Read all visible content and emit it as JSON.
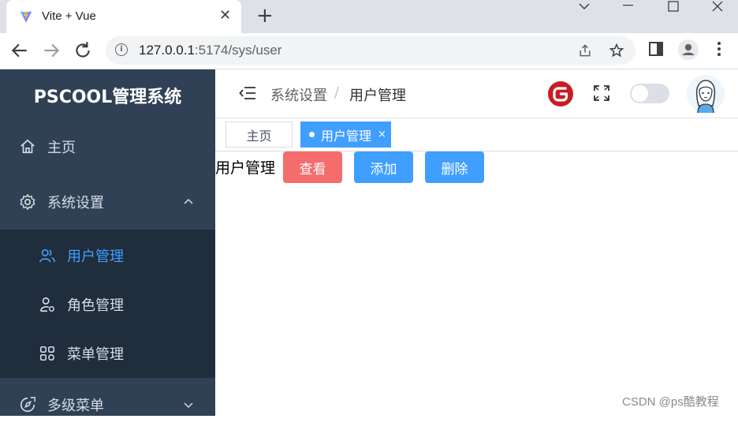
{
  "browser": {
    "tab_title": "Vite + Vue",
    "tab_close": "✕",
    "new_tab": "+",
    "url_host": "127.0.0.1",
    "url_rest": ":5174/sys/user"
  },
  "app": {
    "logo": "PSCOOL管理系统",
    "sidebar": {
      "items": [
        {
          "label": "主页",
          "icon": "home-icon"
        },
        {
          "label": "系统设置",
          "icon": "gear-icon",
          "expanded": true
        },
        {
          "label": "多级菜单",
          "icon": "compass-icon",
          "expanded": false
        }
      ],
      "sub_items": [
        {
          "label": "用户管理",
          "icon": "users-icon",
          "active": true
        },
        {
          "label": "角色管理",
          "icon": "user-gear-icon"
        },
        {
          "label": "菜单管理",
          "icon": "grid-icon"
        }
      ]
    },
    "header": {
      "breadcrumb": [
        "系统设置",
        "用户管理"
      ],
      "breadcrumb_sep": "/"
    },
    "tags": {
      "home": "主页",
      "active": "用户管理",
      "close": "×"
    },
    "content": {
      "title": "用户管理",
      "buttons": [
        {
          "label": "查看",
          "color": "#f56c6c"
        },
        {
          "label": "添加",
          "color": "#409eff"
        },
        {
          "label": "删除",
          "color": "#409eff"
        }
      ]
    },
    "watermark": "CSDN @ps酷教程"
  },
  "colors": {
    "sidebar_bg": "#304156",
    "submenu_bg": "#1f2d3d",
    "accent": "#409eff",
    "danger": "#f56c6c"
  }
}
